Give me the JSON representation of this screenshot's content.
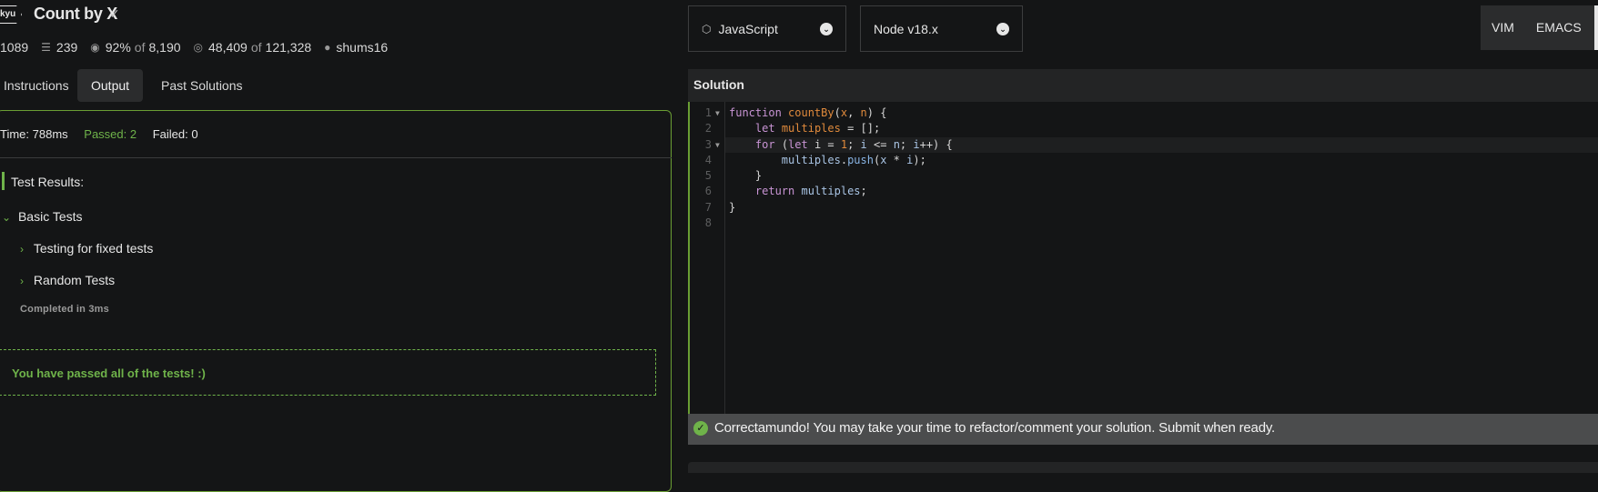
{
  "header": {
    "kyu_label": "kyu",
    "title": "Count by X",
    "check_glyph": "✓",
    "stats": {
      "honor": "1089",
      "collections": "239",
      "satisfaction": "92%",
      "of_word": "of",
      "votes": "8,190",
      "completed": "48,409",
      "attempts": "121,328",
      "author": "shums16"
    }
  },
  "tabs": [
    {
      "label": "Instructions"
    },
    {
      "label": "Output"
    },
    {
      "label": "Past Solutions"
    }
  ],
  "output": {
    "time": "Time: 788ms",
    "passed": "Passed: 2",
    "failed": "Failed: 0",
    "test_results": "Test Results:",
    "groups": [
      {
        "label": "Basic Tests"
      },
      {
        "label": "Testing for fixed tests"
      },
      {
        "label": "Random Tests"
      }
    ],
    "completed": "Completed in 3ms",
    "pass_message": "You have passed all of the tests! :)"
  },
  "language_select": {
    "value": "JavaScript"
  },
  "version_select": {
    "value": "Node v18.x"
  },
  "modes": {
    "vim": "VIM",
    "emacs": "EMACS"
  },
  "solution": {
    "title": "Solution",
    "line_numbers": [
      "1",
      "2",
      "3",
      "4",
      "5",
      "6",
      "7",
      "8"
    ],
    "code_tokens": {
      "kw_function": "function",
      "fn_name": "countBy",
      "param_x": "x",
      "param_n": "n",
      "kw_let": "let",
      "var_multiples": "multiples",
      "kw_for": "for",
      "num_1": "1",
      "method_push": "push",
      "kw_return": "return"
    }
  },
  "status": {
    "message": "Correctamundo! You may take your time to refactor/comment your solution. Submit when ready."
  },
  "colors": {
    "accent": "#6fb34a",
    "border": "#6a9e34",
    "background": "#141516"
  }
}
